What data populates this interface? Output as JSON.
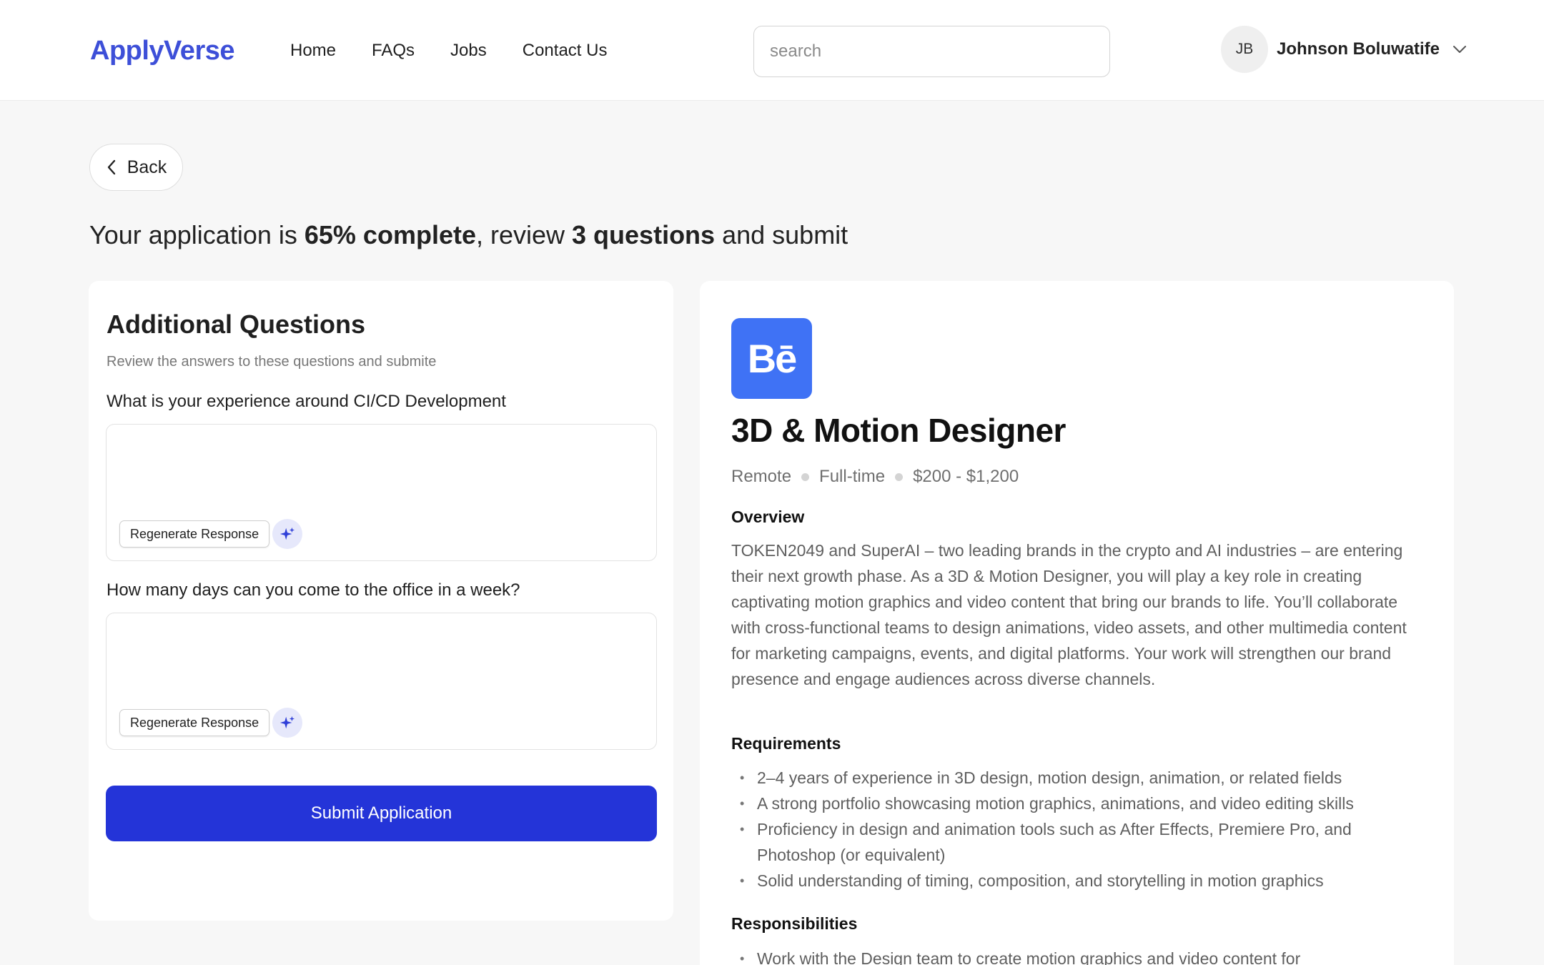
{
  "brand": {
    "logo_text": "ApplyVerse",
    "accent": "#3d4fd8"
  },
  "nav": {
    "items": [
      {
        "label": "Home"
      },
      {
        "label": "FAQs"
      },
      {
        "label": "Jobs"
      },
      {
        "label": "Contact Us"
      }
    ]
  },
  "search": {
    "placeholder": "search",
    "value": ""
  },
  "user": {
    "initials": "JB",
    "name": "Johnson Boluwatife"
  },
  "back": {
    "label": "Back"
  },
  "progress": {
    "prefix": "Your application is ",
    "percent_label": "65% complete",
    "middle": ", review ",
    "questions_label": "3 questions",
    "suffix": " and submit",
    "percent": 65,
    "questions_count": 3
  },
  "questions_card": {
    "title": "Additional Questions",
    "subtitle": "Review the answers to these questions and submite",
    "questions": [
      {
        "label": "What is your experience around CI/CD Development",
        "answer": "",
        "regen_label": "Regenerate Response"
      },
      {
        "label": "How many days can you come to the office in a week?",
        "answer": "",
        "regen_label": "Regenerate Response"
      }
    ],
    "submit_label": "Submit Application",
    "submit_color": "#2434d8"
  },
  "job": {
    "company_logo_text": "Bē",
    "company_logo_color": "#3f72f5",
    "title": "3D & Motion Designer",
    "meta": [
      "Remote",
      "Full-time",
      "$200 - $1,200"
    ],
    "overview_heading": "Overview",
    "overview": "TOKEN2049 and SuperAI – two leading brands in the crypto and AI industries – are entering their next growth phase. As a 3D & Motion Designer, you will play a key role in creating captivating motion graphics and video content that bring our brands to life. You’ll collaborate with cross-functional teams to design animations, video assets, and other multimedia content for marketing campaigns, events, and digital platforms. Your work will strengthen our brand presence and engage audiences across diverse channels.",
    "requirements_heading": "Requirements",
    "requirements": [
      "2–4 years of experience in 3D design, motion design, animation, or related fields",
      "A strong portfolio showcasing motion graphics, animations, and video editing skills",
      "Proficiency in design and animation tools such as After Effects, Premiere Pro, and Photoshop (or equivalent)",
      "Solid understanding of timing, composition, and storytelling in motion graphics"
    ],
    "responsibilities_heading": "Responsibilities",
    "responsibilities": [
      "Work with the Design team to create motion graphics and video content for"
    ]
  }
}
